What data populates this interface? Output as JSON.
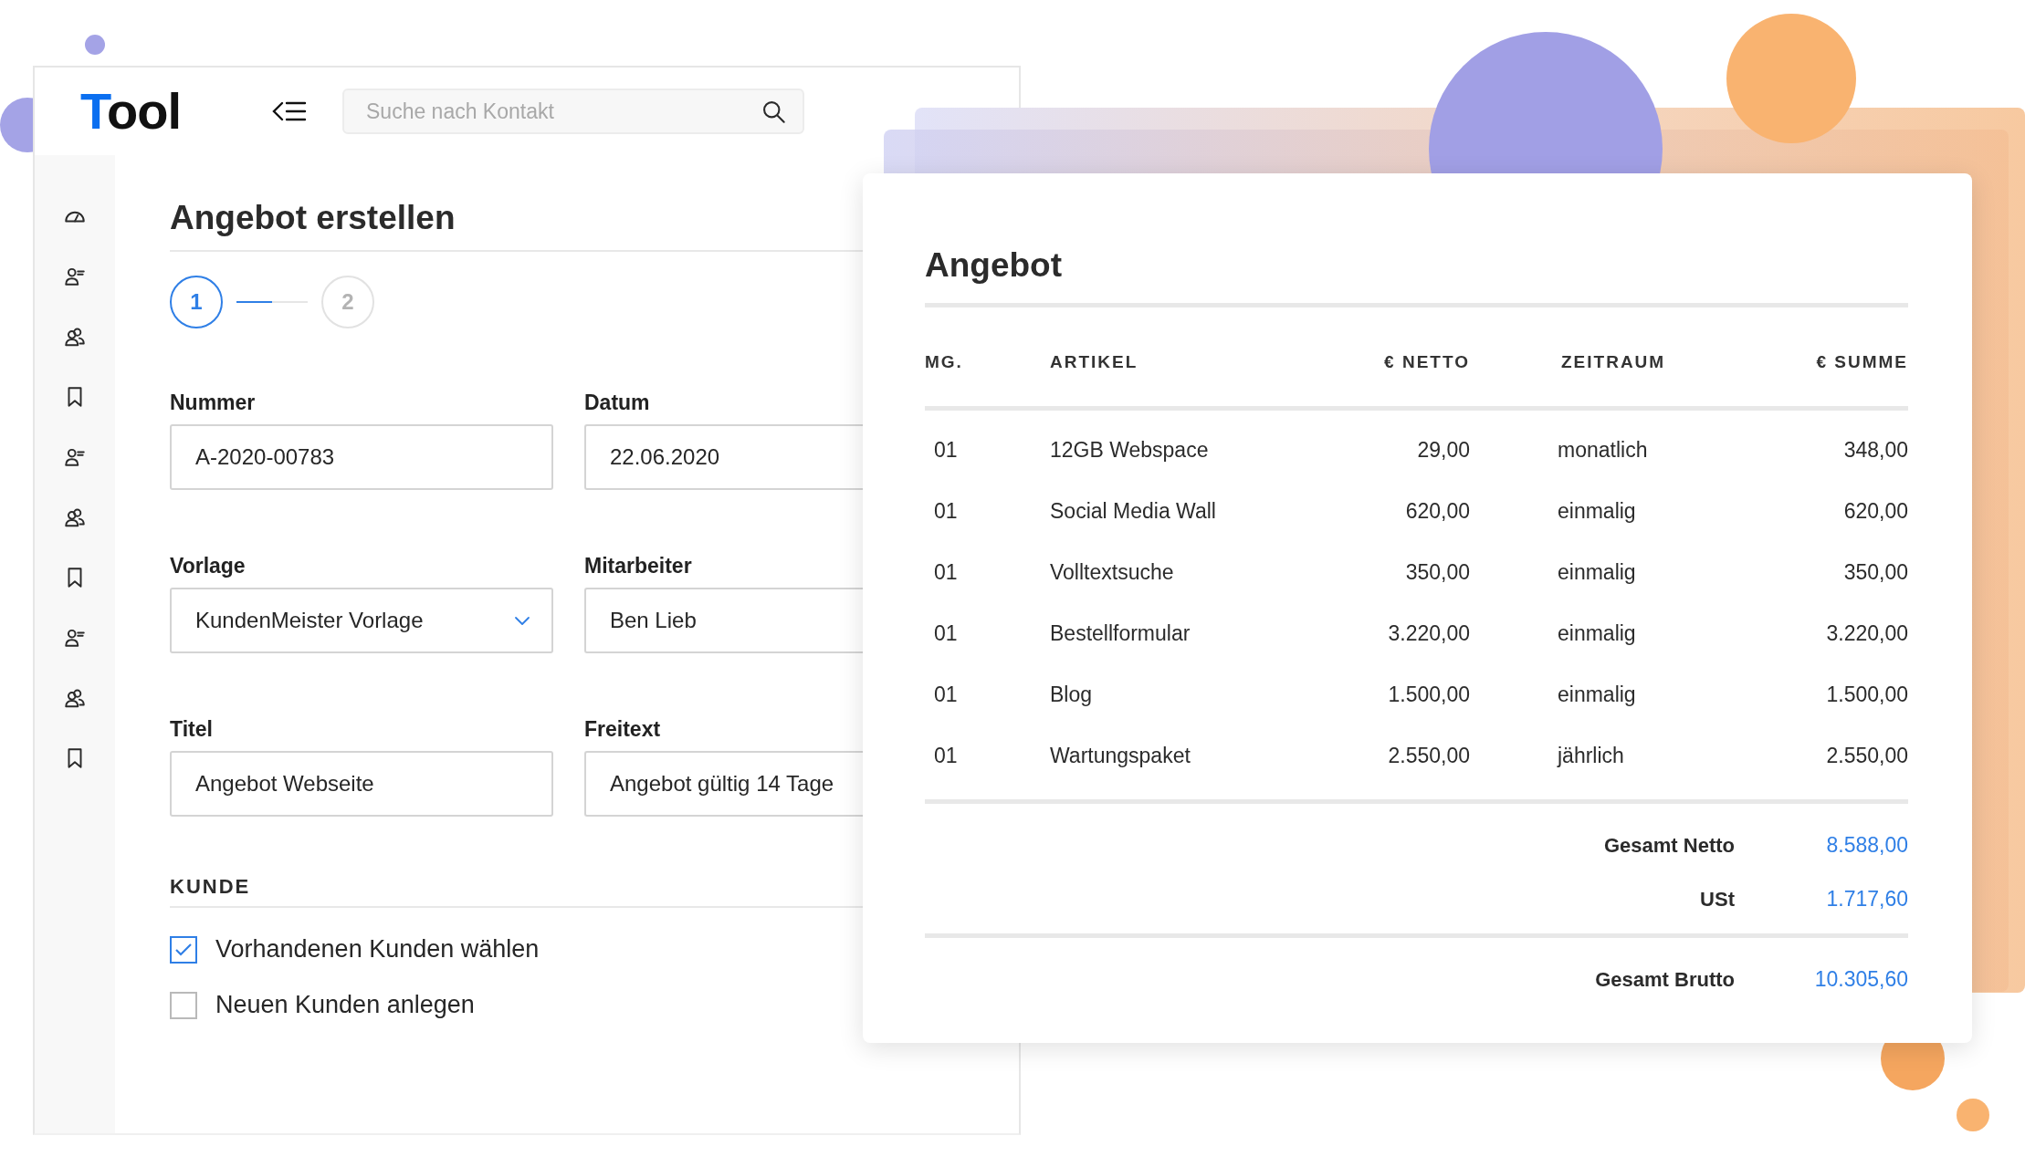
{
  "app": {
    "logo": "Tool",
    "search": {
      "placeholder": "Suche nach Kontakt"
    }
  },
  "form": {
    "title": "Angebot erstellen",
    "steps": [
      {
        "label": "1",
        "selected": true
      },
      {
        "label": "2",
        "selected": false
      }
    ],
    "fields": [
      {
        "label": "Nummer",
        "value": "A-2020-00783",
        "kind": "text"
      },
      {
        "label": "Datum",
        "value": "22.06.2020",
        "kind": "text"
      },
      {
        "label": "Vorlage",
        "value": "KundenMeister Vorlage",
        "kind": "select"
      },
      {
        "label": "Mitarbeiter",
        "value": "Ben Lieb",
        "kind": "text"
      },
      {
        "label": "Titel",
        "value": "Angebot Webseite",
        "kind": "text"
      },
      {
        "label": "Freitext",
        "value": "Angebot gültig 14 Tage",
        "kind": "text"
      }
    ],
    "section": "KUNDE",
    "options": [
      {
        "label": "Vorhandenen Kunden wählen",
        "checked": true
      },
      {
        "label": "Neuen Kunden anlegen",
        "checked": false
      }
    ]
  },
  "offer": {
    "title": "Angebot",
    "columns": [
      "MG.",
      "ARTIKEL",
      "€ NETTO",
      "ZEITRAUM",
      "€ SUMME"
    ],
    "rows": [
      [
        "01",
        "12GB Webspace",
        "29,00",
        "monatlich",
        "348,00"
      ],
      [
        "01",
        "Social Media Wall",
        "620,00",
        "einmalig",
        "620,00"
      ],
      [
        "01",
        "Volltextsuche",
        "350,00",
        "einmalig",
        "350,00"
      ],
      [
        "01",
        "Bestellformular",
        "3.220,00",
        "einmalig",
        "3.220,00"
      ],
      [
        "01",
        "Blog",
        "1.500,00",
        "einmalig",
        "1.500,00"
      ],
      [
        "01",
        "Wartungspaket",
        "2.550,00",
        "jährlich",
        "2.550,00"
      ]
    ],
    "totals": [
      {
        "label": "Gesamt Netto",
        "value": "8.588,00"
      },
      {
        "label": "USt",
        "value": "1.717,60"
      }
    ],
    "grand_total": {
      "label": "Gesamt Brutto",
      "value": "10.305,60"
    }
  }
}
